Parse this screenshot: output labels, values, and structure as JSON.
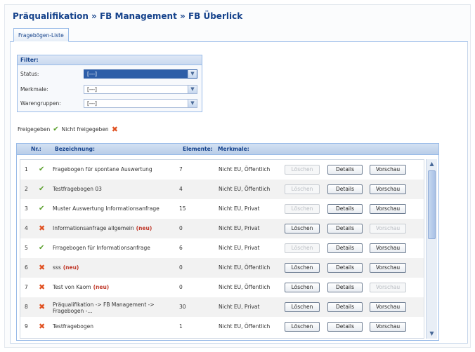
{
  "breadcrumb": "Präqualifikation » FB Management » FB Überlick",
  "tab": "Fragebögen-Liste",
  "filter": {
    "title": "Filter:",
    "status_label": "Status:",
    "status_value": "[---]",
    "merkmale_label": "Merkmale:",
    "merkmale_value": "[---]",
    "warengruppen_label": "Warengruppen:",
    "warengruppen_value": "[---]"
  },
  "legend": {
    "approved": "Freigegeben",
    "not_approved": "Nicht freigegeben"
  },
  "table": {
    "headers": {
      "nr": "Nr.:",
      "bez": "Bezeichnung:",
      "el": "Elemente:",
      "mk": "Merkmale:"
    },
    "rows": [
      {
        "nr": "1",
        "bez": "Fragebogen für spontane Auswertung",
        "bez2": "",
        "neu": "",
        "el": "7",
        "mk": "Nicht EU, Öffentlich",
        "status": "check-icon",
        "del": "Löschen",
        "det": "Details",
        "vor": "Vorschau",
        "del_enabled": false,
        "vor_enabled": true
      },
      {
        "nr": "2",
        "bez": "Testfragebogen 03",
        "bez2": "",
        "neu": "",
        "el": "4",
        "mk": "Nicht EU, Öffentlich",
        "status": "check-icon",
        "del": "Löschen",
        "det": "Details",
        "vor": "Vorschau",
        "del_enabled": false,
        "vor_enabled": true
      },
      {
        "nr": "3",
        "bez": "Muster Auswertung Informationsanfrage",
        "bez2": "",
        "neu": "",
        "el": "15",
        "mk": "Nicht EU, Privat",
        "status": "check-icon",
        "del": "Löschen",
        "det": "Details",
        "vor": "Vorschau",
        "del_enabled": false,
        "vor_enabled": true
      },
      {
        "nr": "4",
        "bez": "Informationsanfrage allgemein",
        "bez2": "",
        "neu": "(neu)",
        "el": "0",
        "mk": "Nicht EU, Privat",
        "status": "cross-icon",
        "del": "Löschen",
        "det": "Details",
        "vor": "Vorschau",
        "del_enabled": true,
        "vor_enabled": false
      },
      {
        "nr": "5",
        "bez": "Frragebogen für Informationsanfrage",
        "bez2": "",
        "neu": "",
        "el": "6",
        "mk": "Nicht EU, Privat",
        "status": "check-icon",
        "del": "Löschen",
        "det": "Details",
        "vor": "Vorschau",
        "del_enabled": false,
        "vor_enabled": true
      },
      {
        "nr": "6",
        "bez": "sss",
        "bez2": "",
        "neu": "(neu)",
        "el": "0",
        "mk": "Nicht EU, Öffentlich",
        "status": "cross-icon",
        "del": "Löschen",
        "det": "Details",
        "vor": "Vorschau",
        "del_enabled": true,
        "vor_enabled": true
      },
      {
        "nr": "7",
        "bez": "Test von Kaom",
        "bez2": "",
        "neu": "(neu)",
        "el": "0",
        "mk": "Nicht EU, Öffentlich",
        "status": "cross-icon",
        "del": "Löschen",
        "det": "Details",
        "vor": "Vorschau",
        "del_enabled": true,
        "vor_enabled": false
      },
      {
        "nr": "8",
        "bez": "Präqualifikation -> FB Management ->",
        "bez2": "Fragebogen -...",
        "neu": "",
        "el": "30",
        "mk": "Nicht EU, Privat",
        "status": "cross-icon",
        "del": "Löschen",
        "det": "Details",
        "vor": "Vorschau",
        "del_enabled": true,
        "vor_enabled": true
      },
      {
        "nr": "9",
        "bez": "Testfragebogen",
        "bez2": "",
        "neu": "",
        "el": "1",
        "mk": "Nicht EU, Öffentlich",
        "status": "cross-icon",
        "del": "Löschen",
        "det": "Details",
        "vor": "Vorschau",
        "del_enabled": true,
        "vor_enabled": true
      }
    ]
  },
  "icons": {
    "check": "check-icon",
    "cross": "cross-icon",
    "dropdown": "chevron-down-icon",
    "scroll_up": "scroll-up-icon",
    "scroll_down": "scroll-down-icon"
  },
  "colors": {
    "brand": "#15428b",
    "approved": "#5aa02c",
    "not_approved": "#e05020",
    "neu": "#c0392b"
  }
}
